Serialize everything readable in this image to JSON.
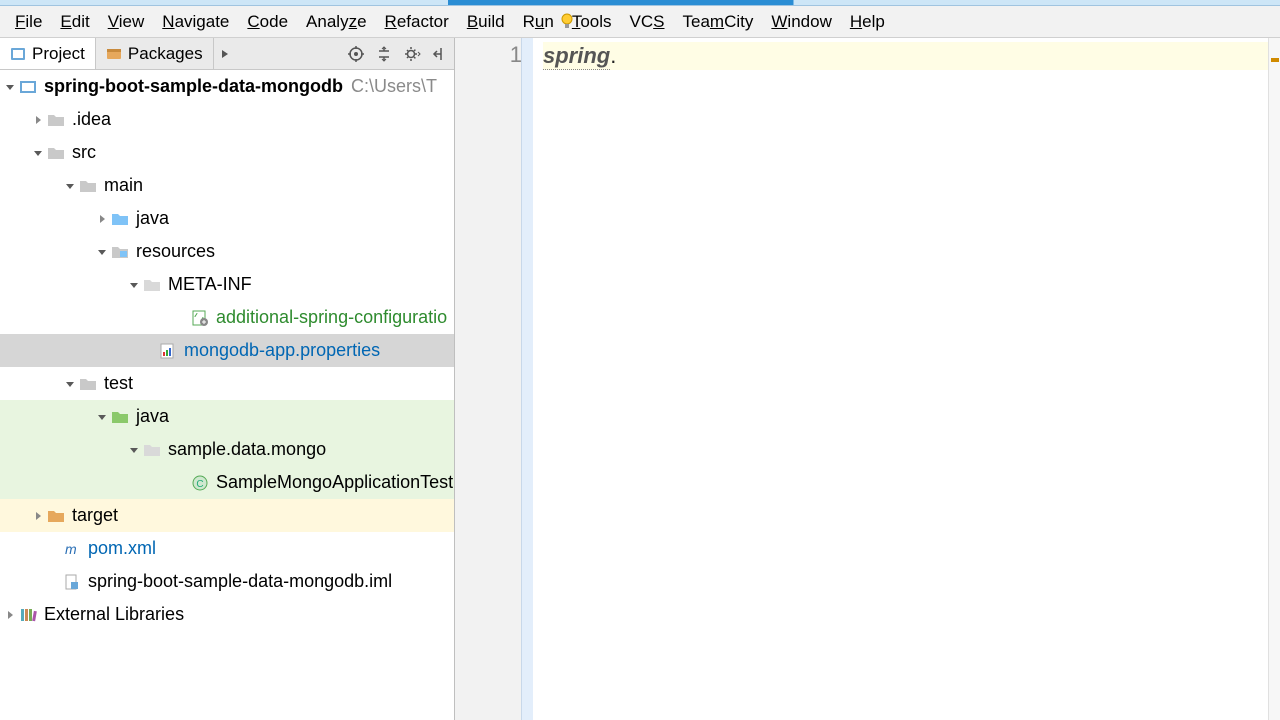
{
  "menu": [
    "File",
    "Edit",
    "View",
    "Navigate",
    "Code",
    "Analyze",
    "Refactor",
    "Build",
    "Run",
    "Tools",
    "VCS",
    "TeamCity",
    "Window",
    "Help"
  ],
  "menu_ul": [
    "F",
    "E",
    "V",
    "N",
    "C",
    "z",
    "R",
    "B",
    "u",
    "T",
    "S",
    "m",
    "W",
    "H"
  ],
  "tabs": {
    "project": "Project",
    "packages": "Packages"
  },
  "tree": {
    "root": {
      "name": "spring-boot-sample-data-mongodb",
      "path": "C:\\Users\\T"
    },
    "idea": ".idea",
    "src": "src",
    "main": "main",
    "java": "java",
    "resources": "resources",
    "metainf": "META-INF",
    "addl": "additional-spring-configuratio",
    "props": "mongodb-app.properties",
    "test": "test",
    "java2": "java",
    "pkg": "sample.data.mongo",
    "testcls": "SampleMongoApplicationTest",
    "target": "target",
    "pom": "pom.xml",
    "iml": "spring-boot-sample-data-mongodb.iml",
    "ext": "External Libraries"
  },
  "editor": {
    "line_no": "1",
    "token1": "spring",
    "token2": "."
  }
}
